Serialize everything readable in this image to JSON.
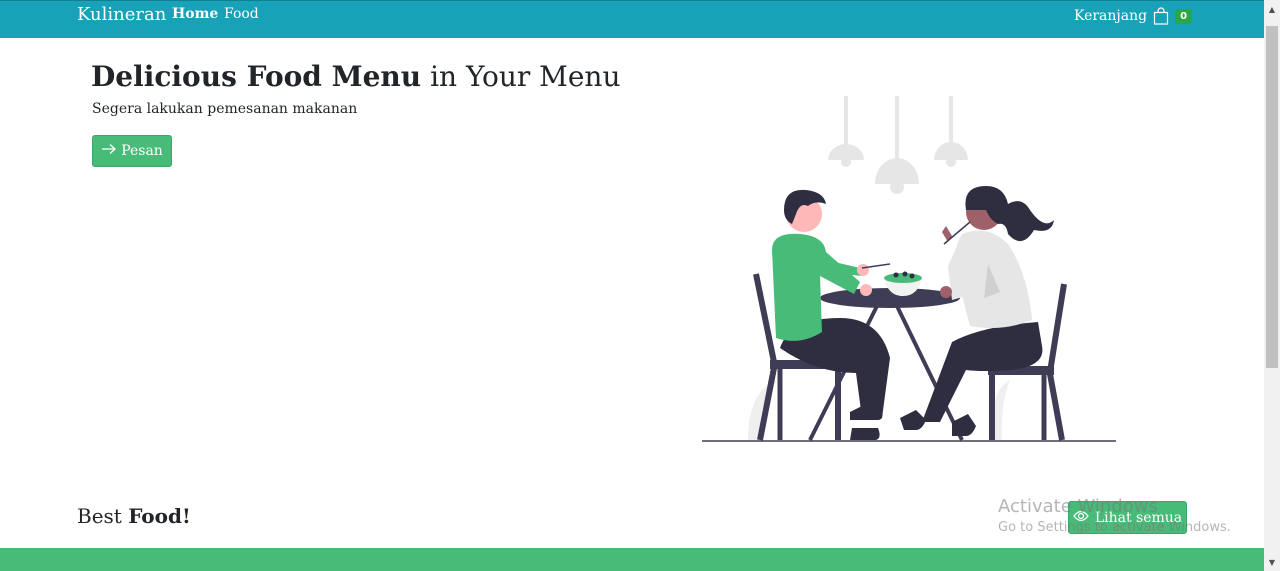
{
  "navbar": {
    "brand": "Kulineran",
    "links": [
      {
        "label": "Home",
        "active": true
      },
      {
        "label": "Food",
        "active": false
      }
    ],
    "cart": {
      "label": "Keranjang",
      "count": "0",
      "icon": "shopping-bag-icon"
    }
  },
  "hero": {
    "title_bold": "Delicious Food Menu",
    "title_rest": "in Your Menu",
    "subtitle": "Segera lakukan pemesanan makanan",
    "button_label": "Pesan",
    "button_icon": "arrow-right-icon",
    "illustration": "couple-dining-illustration"
  },
  "section": {
    "title_light": "Best",
    "title_bold": "Food!",
    "button_label": "Lihat semua",
    "button_icon": "eye-icon"
  },
  "watermark": {
    "line1": "Activate Windows",
    "line2": "Go to Settings to activate Windows."
  },
  "colors": {
    "navbar": "#17a2b8",
    "button": "#48bb78",
    "badge": "#28a745"
  }
}
